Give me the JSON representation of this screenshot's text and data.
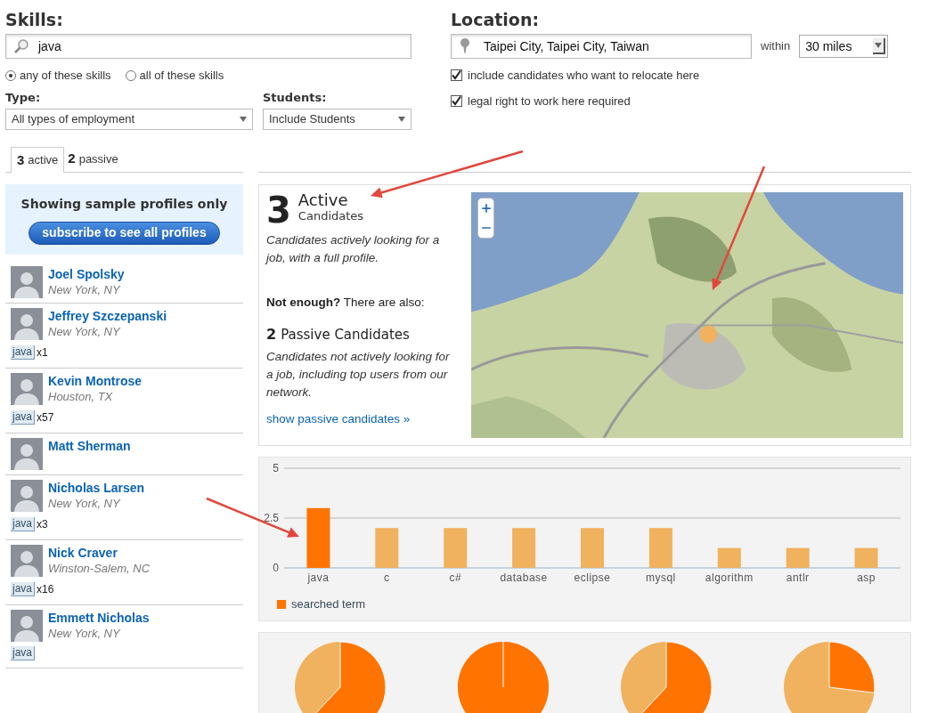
{
  "skills": {
    "label": "Skills:",
    "value": "java",
    "match_options": [
      {
        "label": "any of these skills",
        "selected": true
      },
      {
        "label": "all of these skills",
        "selected": false
      }
    ]
  },
  "type": {
    "label": "Type:",
    "value": "All types of employment"
  },
  "students": {
    "label": "Students:",
    "value": "Include Students"
  },
  "location": {
    "label": "Location:",
    "value": "Taipei City, Taipei City, Taiwan",
    "within_label": "within",
    "radius": "30 miles",
    "options": [
      {
        "label": "include candidates who want to relocate here",
        "checked": true
      },
      {
        "label": "legal right to work here required",
        "checked": true
      }
    ]
  },
  "tabs": [
    {
      "count": "3",
      "label": "active",
      "selected": true
    },
    {
      "count": "2",
      "label": "passive",
      "selected": false
    }
  ],
  "sample_notice": {
    "text": "Showing sample profiles only",
    "button": "subscribe to see all profiles"
  },
  "candidates": [
    {
      "name": "Joel Spolsky",
      "location": "New York, NY"
    },
    {
      "name": "Jeffrey Szczepanski",
      "location": "New York, NY",
      "tag": "java",
      "tag_count": "x1"
    },
    {
      "name": "Kevin Montrose",
      "location": "Houston, TX",
      "tag": "java",
      "tag_count": "x57"
    },
    {
      "name": "Matt Sherman"
    },
    {
      "name": "Nicholas Larsen",
      "location": "New York, NY",
      "tag": "java",
      "tag_count": "x3"
    },
    {
      "name": "Nick Craver",
      "location": "Winston-Salem, NC",
      "tag": "java",
      "tag_count": "x16"
    },
    {
      "name": "Emmett Nicholas",
      "location": "New York, NY",
      "tag": "java"
    }
  ],
  "summary": {
    "active_count": "3",
    "active_title": "Active",
    "active_subtitle": "Candidates",
    "active_description": "Candidates actively looking for a job, with a full profile.",
    "not_enough": "**Not enough?** There are also:",
    "passive_count": "2",
    "passive_title": "Passive Candidates",
    "passive_description": "Candidates not actively looking for a job, including top users from our network.",
    "link": "show passive candidates »"
  },
  "skill_chart": {
    "chart_data": {
      "type": "bar",
      "categories": [
        "java",
        "c",
        "c#",
        "database",
        "eclipse",
        "mysql",
        "algorithm",
        "antlr",
        "asp"
      ],
      "stacked": true,
      "ylim": [
        0,
        5
      ],
      "yticks": [
        0,
        {
          "value": 2.5,
          "label": "2.5"
        },
        5
      ],
      "series": [
        {
          "name": "searched term",
          "color": "#ff7400",
          "values": [
            3,
            null,
            null,
            null,
            null,
            null,
            null,
            null,
            null
          ]
        },
        {
          "color": "#f0b25e",
          "values": [
            null,
            2,
            2,
            2,
            2,
            2,
            1,
            1,
            1
          ]
        }
      ]
    }
  }
}
